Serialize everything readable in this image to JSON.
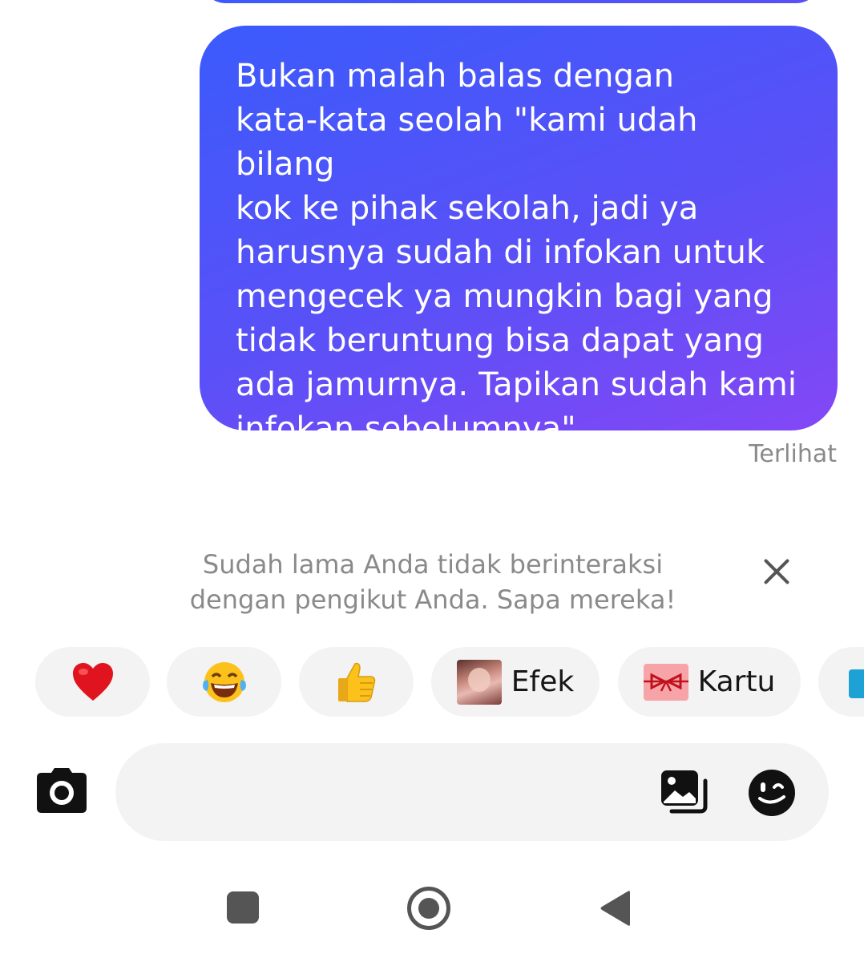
{
  "message": {
    "text": "Bukan malah balas dengan\nkata-kata seolah \"kami udah bilang\nkok ke pihak sekolah, jadi ya\nharusnya sudah di infokan untuk\nmengecek ya mungkin bagi yang\ntidak beruntung bisa dapat yang\nada jamurnya. Tapikan sudah kami\ninfokan sebelumnya\"",
    "status": "Terlihat"
  },
  "nudge": {
    "text": "Sudah lama Anda tidak berinteraksi\ndengan pengikut Anda. Sapa mereka!"
  },
  "quick_replies": [
    {
      "type": "emoji",
      "icon": "heart-emoji"
    },
    {
      "type": "emoji",
      "icon": "laughing-tears-emoji"
    },
    {
      "type": "emoji",
      "icon": "thumbs-up-emoji"
    },
    {
      "type": "effect",
      "label": "Efek"
    },
    {
      "type": "card",
      "label": "Kartu"
    }
  ],
  "composer": {
    "placeholder": ""
  },
  "colors": {
    "bubble_start": "#3b5bfc",
    "bubble_end": "#8447f6",
    "chip_bg": "#f3f3f3",
    "muted_text": "#8a8a8a"
  },
  "icons": {
    "camera": "camera-icon",
    "gallery": "gallery-icon",
    "sticker": "sticker-icon",
    "close": "close-icon",
    "nav_recent": "recent-apps-icon",
    "nav_home": "home-icon",
    "nav_back": "back-icon"
  }
}
